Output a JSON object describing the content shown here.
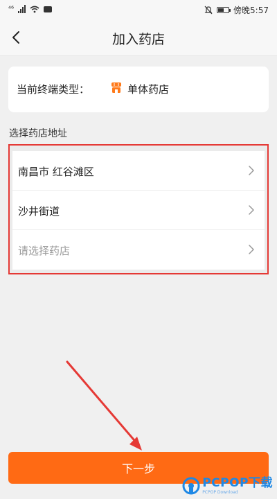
{
  "status_bar": {
    "carrier_mark": "⁴⁶",
    "time": "傍晚5:57",
    "battery_level": 0.55,
    "icons": [
      "signal-icon",
      "wifi-icon",
      "message-icon",
      "mute-icon",
      "battery-icon"
    ]
  },
  "nav": {
    "title": "加入药店",
    "back_icon": "chevron-left-icon"
  },
  "terminal": {
    "label": "当前终端类型：",
    "value": "单体药店",
    "icon": "store-icon",
    "icon_color": "#ff7a1a"
  },
  "address": {
    "section_label": "选择药店地址",
    "rows": [
      {
        "text": "南昌市 红谷滩区",
        "placeholder": false
      },
      {
        "text": "沙井街道",
        "placeholder": false
      },
      {
        "text": "请选择药店",
        "placeholder": true
      }
    ],
    "highlight_color": "#e53935"
  },
  "next_button": {
    "label": "下一步",
    "color": "#ff6a14"
  },
  "watermark": {
    "text": "PCPOP下载",
    "sub": "PCPOP Download",
    "color": "#1e88e5"
  }
}
